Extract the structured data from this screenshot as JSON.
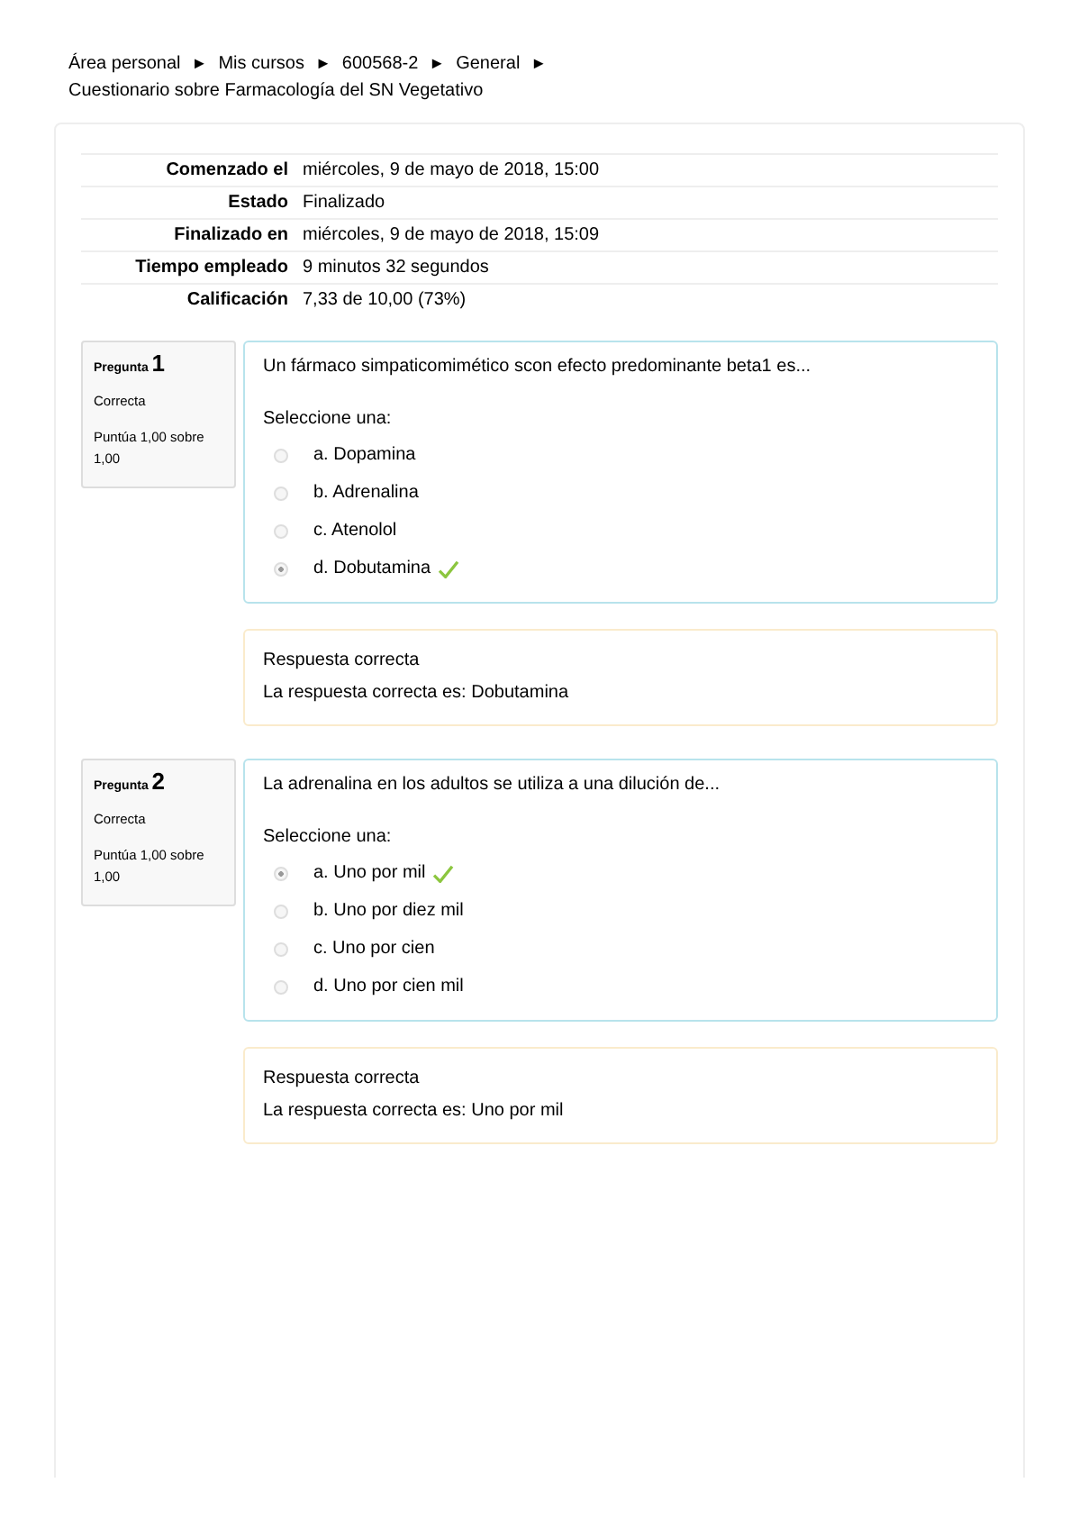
{
  "breadcrumb": [
    {
      "label": "Área personal",
      "separator": "►"
    },
    {
      "label": "Mis cursos",
      "separator": "►"
    },
    {
      "label": "600568-2",
      "separator": "►"
    },
    {
      "label": "General",
      "separator": "►"
    },
    {
      "label": "Cuestionario sobre Farmacología del SN Vegetativo"
    }
  ],
  "summary": [
    {
      "label": "Comenzado el",
      "value": "miércoles, 9 de mayo de 2018, 15:00"
    },
    {
      "label": "Estado",
      "value": "Finalizado"
    },
    {
      "label": "Finalizado en",
      "value": "miércoles, 9 de mayo de 2018, 15:09"
    },
    {
      "label": "Tiempo empleado",
      "value": "9 minutos 32 segundos"
    },
    {
      "label": "Calificación",
      "value": "7,33 de 10,00 (73%)"
    }
  ],
  "questions": [
    {
      "label": "Pregunta",
      "number": "1",
      "status": "Correcta",
      "grade": "Puntúa 1,00 sobre 1,00",
      "text": "Un fármaco simpaticomimético scon efecto predominante beta1 es...",
      "prompt": "Seleccione una:",
      "options": [
        {
          "label": "a. Dopamina",
          "selected": false,
          "correct": false
        },
        {
          "label": "b. Adrenalina",
          "selected": false,
          "correct": false
        },
        {
          "label": "c. Atenolol",
          "selected": false,
          "correct": false
        },
        {
          "label": "d. Dobutamina",
          "selected": true,
          "correct": true
        }
      ],
      "feedback_title": "Respuesta correcta",
      "feedback": "La respuesta correcta es: Dobutamina"
    },
    {
      "label": "Pregunta",
      "number": "2",
      "status": "Correcta",
      "grade": "Puntúa 1,00 sobre 1,00",
      "text": "La adrenalina en los adultos se utiliza a una dilución de...",
      "prompt": "Seleccione una:",
      "options": [
        {
          "label": "a. Uno por mil",
          "selected": true,
          "correct": true
        },
        {
          "label": "b. Uno por diez mil",
          "selected": false,
          "correct": false
        },
        {
          "label": "c. Uno por cien",
          "selected": false,
          "correct": false
        },
        {
          "label": "d. Uno por cien mil",
          "selected": false,
          "correct": false
        }
      ],
      "feedback_title": "Respuesta correcta",
      "feedback": "La respuesta correcta es: Uno por mil"
    }
  ]
}
